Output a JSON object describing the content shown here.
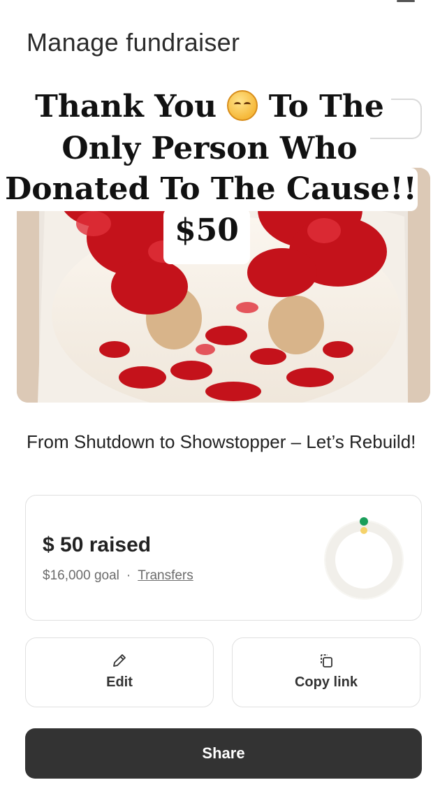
{
  "header": {
    "title": "Manage fundraiser"
  },
  "overlay_caption": {
    "line1_before": "Thank You",
    "line1_emoji": "smiling-face-icon",
    "line1_after": "To The",
    "line2": "Only Person Who",
    "line3": "Donated To The Cause!!",
    "line4": "$50"
  },
  "fundraiser": {
    "title": "From Shutdown to Showstopper – Let’s Rebuild!",
    "raised_text": "$ 50 raised",
    "goal_text": "$16,000 goal",
    "separator": "·",
    "transfers_label": "Transfers",
    "progress_fraction": 0.003125,
    "ring_colors": {
      "track": "#f1efea",
      "progress": "#1a9e5a",
      "marker": "#f5d26a"
    }
  },
  "actions": {
    "edit_label": "Edit",
    "edit_icon": "pencil-icon",
    "copy_label": "Copy link",
    "copy_icon": "copy-icon",
    "share_label": "Share"
  },
  "colors": {
    "share_bg": "#333333",
    "card_border": "#e0e0e0"
  }
}
